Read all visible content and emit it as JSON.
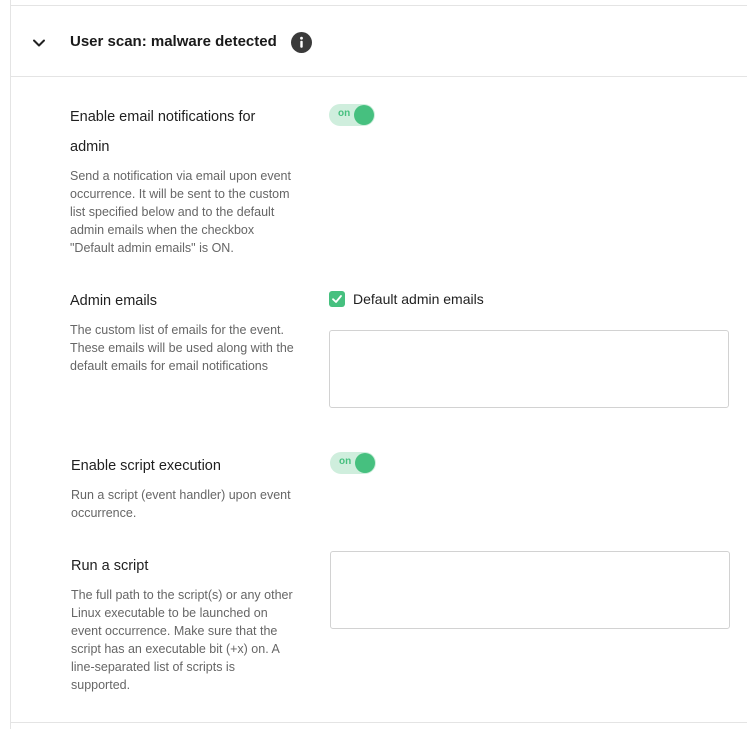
{
  "section": {
    "title": "User scan: malware detected",
    "collapse_icon": "chevron-down-icon",
    "info_icon": "info-icon"
  },
  "email_notifications": {
    "label_line1": "Enable email notifications for",
    "label_line2": "admin",
    "toggle_text": "on",
    "toggle_state": "on",
    "description": [
      "Send a notification via email upon event",
      "occurrence. It will be sent to the custom",
      "list specified below and to the default",
      "admin emails when the checkbox",
      "\"Default admin emails\" is ON."
    ]
  },
  "admin_emails": {
    "label": "Admin emails",
    "checkbox_label": "Default admin emails",
    "checkbox_checked": true,
    "value": "",
    "description": [
      "The custom list of emails for the event.",
      "These emails will be used along with the",
      "default emails for email notifications"
    ]
  },
  "script_execution": {
    "label": "Enable script execution",
    "toggle_text": "on",
    "toggle_state": "on",
    "description": [
      "Run a script (event handler) upon event",
      "occurrence."
    ]
  },
  "run_script": {
    "label": "Run a script",
    "value": "",
    "description": [
      "The full path to the script(s) or any other",
      "Linux executable to be launched on",
      "event occurrence. Make sure that the",
      "script has an executable bit (+x) on. A",
      "line-separated list of scripts is",
      "supported."
    ]
  },
  "colors": {
    "accent": "#46c07f",
    "toggle_track": "#cfeedd",
    "border": "#e4e4e4"
  }
}
